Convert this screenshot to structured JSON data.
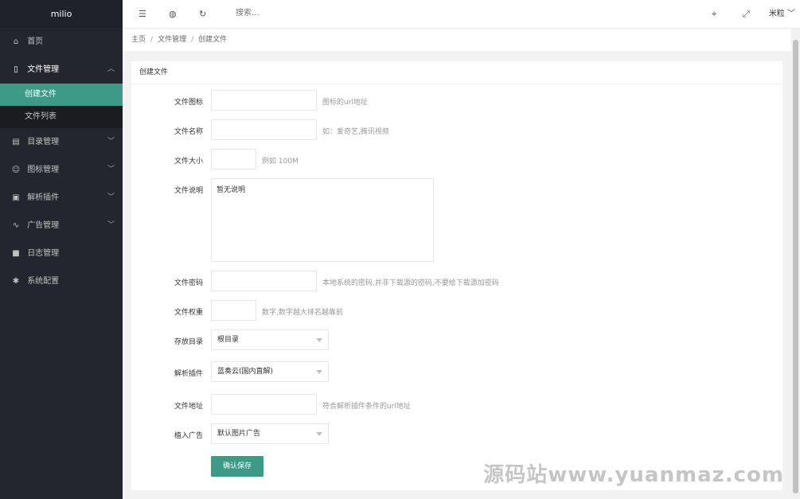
{
  "app": {
    "logo": "milio"
  },
  "sidebar": {
    "items": [
      {
        "label": "首页",
        "icon": "home-icon",
        "glyph": "⌂"
      },
      {
        "label": "文件管理",
        "icon": "file-icon",
        "glyph": "▯",
        "open": true,
        "children": [
          {
            "label": "创建文件",
            "active": true
          },
          {
            "label": "文件列表"
          }
        ]
      },
      {
        "label": "目录管理",
        "icon": "folder-icon",
        "glyph": "▤"
      },
      {
        "label": "图标管理",
        "icon": "smile-icon",
        "glyph": "☺"
      },
      {
        "label": "解析插件",
        "icon": "plugin-icon",
        "glyph": "▣"
      },
      {
        "label": "广告管理",
        "icon": "pulse-icon",
        "glyph": "∿"
      },
      {
        "label": "日志管理",
        "icon": "log-icon",
        "glyph": "■"
      },
      {
        "label": "系统配置",
        "icon": "gear-icon",
        "glyph": "✱"
      }
    ]
  },
  "header": {
    "search_placeholder": "搜索...",
    "user": "米粒"
  },
  "breadcrumb": [
    "主页",
    "文件管理",
    "创建文件"
  ],
  "form": {
    "title": "创建文件",
    "fields": {
      "icon": {
        "label": "文件图标",
        "value": "",
        "hint": "图标的url地址"
      },
      "name": {
        "label": "文件名称",
        "value": "",
        "hint": "如：爱奇艺,腾讯视频"
      },
      "size": {
        "label": "文件大小",
        "value": "",
        "hint": "例如 100M"
      },
      "desc": {
        "label": "文件说明",
        "value": "暂无说明"
      },
      "password": {
        "label": "文件密码",
        "value": "",
        "hint": "本地系统的密码,并非下载源的密码,不要给下载源加密码"
      },
      "weight": {
        "label": "文件权重",
        "value": "",
        "hint": "数字,数字越大排名越靠前"
      },
      "dir": {
        "label": "存放目录",
        "selected": "根目录"
      },
      "plugin": {
        "label": "解析插件",
        "selected": "蓝奏云(国内直解)"
      },
      "url": {
        "label": "文件地址",
        "value": "",
        "hint": "符合解析插件条件的url地址"
      },
      "ad": {
        "label": "植入广告",
        "selected": "默认图片广告"
      }
    },
    "submit": "确认保存"
  },
  "watermark": "源码站www.yuanmaz.com"
}
